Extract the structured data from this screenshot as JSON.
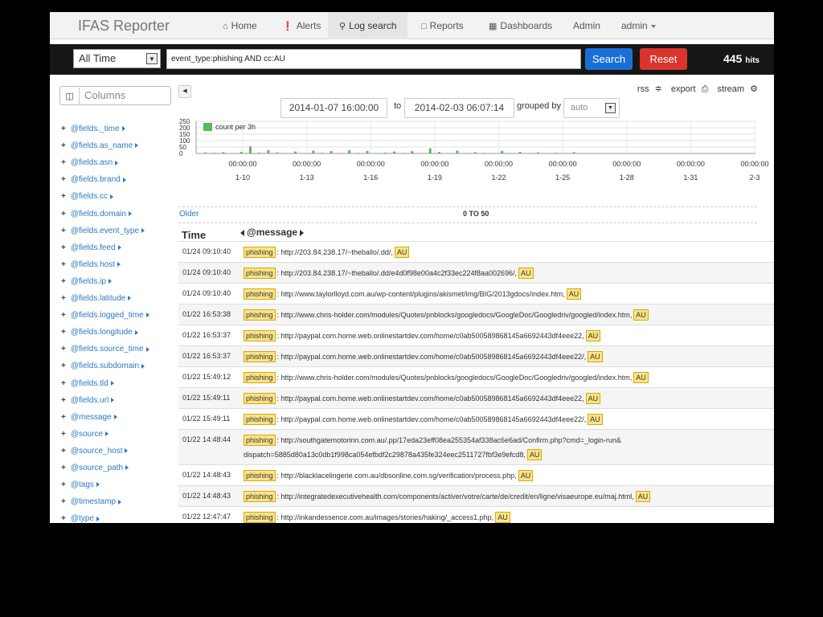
{
  "app": {
    "brand": "IFAS Reporter"
  },
  "nav": {
    "items": [
      {
        "label": "Home",
        "icon": "home-icon"
      },
      {
        "label": "Alerts",
        "icon": "alert-icon"
      },
      {
        "label": "Log search",
        "icon": "search-icon"
      },
      {
        "label": "Reports",
        "icon": "document-icon"
      },
      {
        "label": "Dashboards",
        "icon": "grid-icon"
      },
      {
        "label": "Admin"
      }
    ],
    "user": "admin"
  },
  "query": {
    "timeframe": "All Time",
    "text": "event_type:phishing AND cc:AU",
    "search_label": "Search",
    "reset_label": "Reset",
    "hits_count": "445",
    "hits_label": "hits"
  },
  "sidebar": {
    "columns_label": "Columns",
    "fields": [
      "@fields._time",
      "@fields.as_name",
      "@fields.asn",
      "@fields.brand",
      "@fields.cc",
      "@fields.domain",
      "@fields.event_type",
      "@fields.feed",
      "@fields.host",
      "@fields.ip",
      "@fields.latitude",
      "@fields.logged_time",
      "@fields.longitude",
      "@fields.source_time",
      "@fields.subdomain",
      "@fields.tld",
      "@fields.url",
      "@message",
      "@source",
      "@source_host",
      "@source_path",
      "@tags",
      "@timestamp",
      "@type"
    ]
  },
  "toolbar": {
    "rss": "rss",
    "export": "export",
    "stream": "stream",
    "date_from": "2014-01-07 16:00:00",
    "to_label": "to",
    "date_to": "2014-02-03 06:07:14",
    "grouped_by_label": "grouped by",
    "interval": "auto"
  },
  "chart_data": {
    "type": "bar",
    "legend": "count per 3h",
    "y_ticks": [
      "250",
      "200",
      "150",
      "100",
      "50",
      "0"
    ],
    "ylim": [
      0,
      250
    ],
    "x_labels": [
      {
        "time": "00:00:00",
        "date": "1-10"
      },
      {
        "time": "00:00:00",
        "date": "1-13"
      },
      {
        "time": "00:00:00",
        "date": "1-16"
      },
      {
        "time": "00:00:00",
        "date": "1-19"
      },
      {
        "time": "00:00:00",
        "date": "1-22"
      },
      {
        "time": "00:00:00",
        "date": "1-25"
      },
      {
        "time": "00:00:00",
        "date": "1-28"
      },
      {
        "time": "00:00:00",
        "date": "1-31"
      },
      {
        "time": "00:00:00",
        "date": "2-3"
      }
    ],
    "values": [
      8,
      5,
      10,
      3,
      12,
      55,
      6,
      25,
      8,
      4,
      15,
      3,
      22,
      5,
      18,
      3,
      25,
      4,
      20,
      2,
      6,
      15,
      4,
      18,
      3,
      40,
      12,
      3,
      22,
      4,
      10,
      4,
      3,
      20,
      3,
      12,
      2,
      8,
      2,
      5,
      3,
      10
    ],
    "series_color": "#5cb85c"
  },
  "results": {
    "older_label": "Older",
    "range_label": "0 TO 50",
    "time_header": "Time",
    "message_header": "@message",
    "rows": [
      {
        "time": "01/24 09:10:40",
        "tag": "phishing",
        "url": ": http://203.84.238.17/~theballo/.dd/,",
        "cc": "AU"
      },
      {
        "time": "01/24 09:10:40",
        "tag": "phishing",
        "url": ": http://203.84.238.17/~theballo/.dd/e4d0f98e00a4c2f33ec224f8aa002696/,",
        "cc": "AU"
      },
      {
        "time": "01/24 09:10:40",
        "tag": "phishing",
        "url": ": http://www.taylorlloyd.com.au/wp-content/plugins/akismet/img/BIG/2013gdocs/index.htm,",
        "cc": "AU"
      },
      {
        "time": "01/22 16:53:38",
        "tag": "phishing",
        "url": ": http://www.chris-holder.com/modules/Quotes/pnblocks/googledocs/GoogleDoc/Googledriv/googled/index.htm,",
        "cc": "AU"
      },
      {
        "time": "01/22 16:53:37",
        "tag": "phishing",
        "url": ": http://paypal.com.home.web.onlinestartdev.com/home/c0ab500589868145a6692443df4eee22,",
        "cc": "AU"
      },
      {
        "time": "01/22 16:53:37",
        "tag": "phishing",
        "url": ": http://paypal.com.home.web.onlinestartdev.com/home/c0ab500589868145a6692443df4eee22/,",
        "cc": "AU"
      },
      {
        "time": "01/22 15:49:12",
        "tag": "phishing",
        "url": ": http://www.chris-holder.com/modules/Quotes/pnblocks/googledocs/GoogleDoc/Googledriv/googled/index.htm,",
        "cc": "AU"
      },
      {
        "time": "01/22 15:49:11",
        "tag": "phishing",
        "url": ": http://paypal.com.home.web.onlinestartdev.com/home/c0ab500589868145a6692443df4eee22,",
        "cc": "AU"
      },
      {
        "time": "01/22 15:49:11",
        "tag": "phishing",
        "url": ": http://paypal.com.home.web.onlinestartdev.com/home/c0ab500589868145a6692443df4eee22/,",
        "cc": "AU"
      },
      {
        "time": "01/22 14:48:44",
        "tag": "phishing",
        "url": ": http://southgatemotorinn.com.au/.pp/17eda23eff08ea255354af338ac6e6ad/Confirm.php?cmd=_login-run&",
        "url2": "dispatch=5885d80a13c0db1f998ca054efbdf2c29878a435fe324eec2511727fbf3e9efcd8,",
        "cc": "AU"
      },
      {
        "time": "01/22 14:48:43",
        "tag": "phishing",
        "url": ": http://blacklacelingerie.com.au/dbsonline.com.sg/verification/process.php,",
        "cc": "AU"
      },
      {
        "time": "01/22 14:48:43",
        "tag": "phishing",
        "url": ": http://integratedexecutivehealth.com/components/activer/votre/carte/de/credit/en/ligne/visaeurope.eu/maj.html,",
        "cc": "AU"
      },
      {
        "time": "01/22 12:47:47",
        "tag": "phishing",
        "url": ": http://inkandessence.com.au/images/stories/haking/_access1.php,",
        "cc": "AU"
      }
    ]
  }
}
